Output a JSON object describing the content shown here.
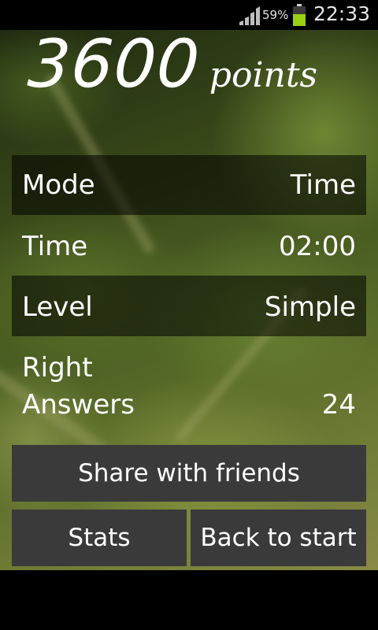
{
  "status_bar": {
    "battery_percent": "59%",
    "time": "22:33",
    "signal_icon": "signal-bars-icon",
    "battery_icon": "battery-icon",
    "battery_color": "#9ad010"
  },
  "score": {
    "value": "3600",
    "unit": "points"
  },
  "stats": [
    {
      "label": "Mode",
      "value": "Time"
    },
    {
      "label": "Time",
      "value": "02:00"
    },
    {
      "label": "Level",
      "value": "Simple"
    },
    {
      "label": "Right Answers",
      "label_line1": "Right",
      "label_line2": "Answers",
      "value": "24"
    }
  ],
  "buttons": {
    "share": "Share with friends",
    "stats": "Stats",
    "back": "Back to start"
  },
  "colors": {
    "button_bg": "#3a3a3a",
    "text": "#ffffff"
  }
}
